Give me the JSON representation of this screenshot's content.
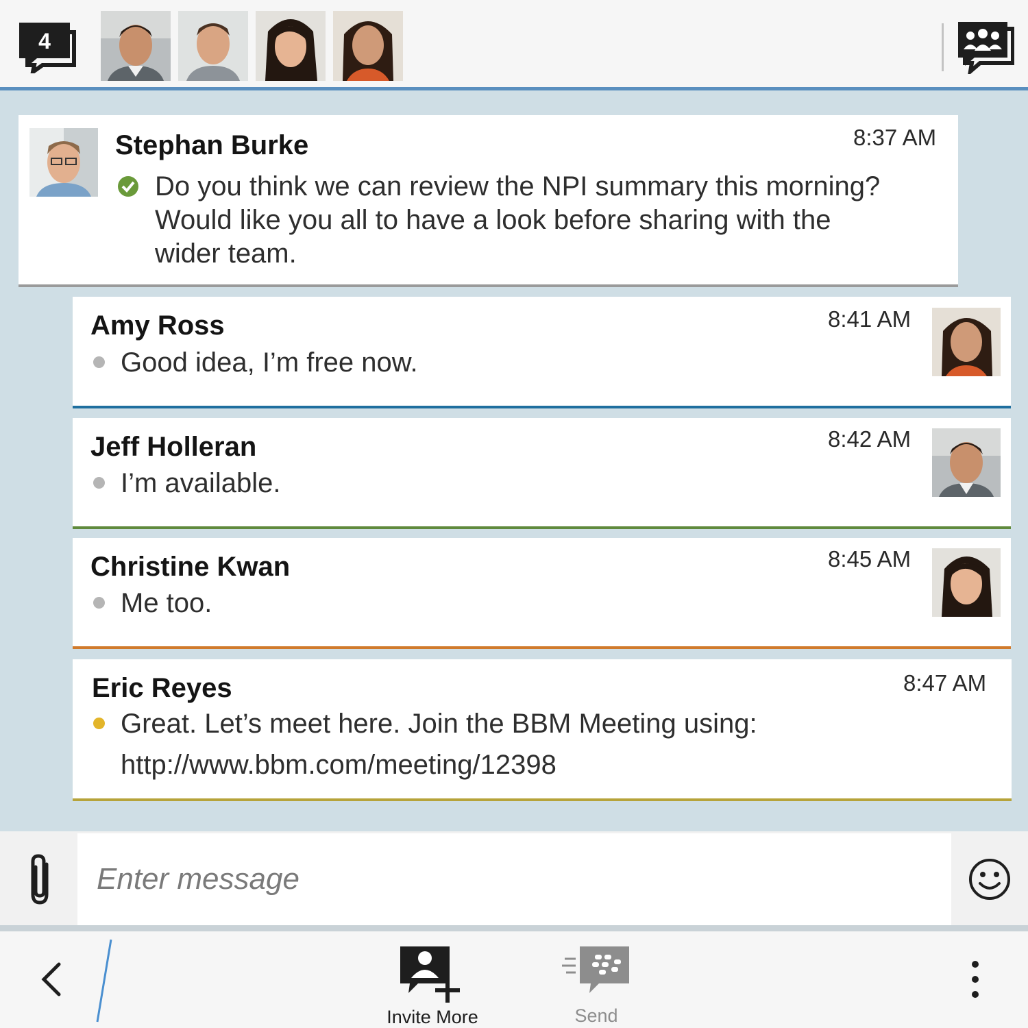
{
  "header": {
    "chat_count": "4",
    "participants": [
      "Jeff Holleran",
      "Stephan Burke",
      "Christine Kwan",
      "Amy Ross"
    ]
  },
  "messages": [
    {
      "name": "Stephan Burke",
      "time": "8:37 AM",
      "lines": [
        "Do you think we can review the NPI summary this morning?",
        "Would like you all to have a look before sharing with the",
        "wider team."
      ],
      "status": "delivered-check",
      "accent": "#9a9a9a"
    },
    {
      "name": "Amy Ross",
      "time": "8:41 AM",
      "text": "Good idea, I’m free now.",
      "accent": "#1f6f9f"
    },
    {
      "name": "Jeff Holleran",
      "time": "8:42 AM",
      "text": "I’m available.",
      "accent": "#5f8a3c"
    },
    {
      "name": "Christine Kwan",
      "time": "8:45 AM",
      "text": "Me too.",
      "accent": "#d07a2c"
    },
    {
      "name": "Eric Reyes",
      "time": "8:47 AM",
      "text": "Great. Let’s meet here. Join the BBM Meeting using:",
      "link": "http://www.bbm.com/meeting/12398",
      "accent": "#b6a33a"
    }
  ],
  "composer": {
    "placeholder": "Enter message"
  },
  "toolbar": {
    "invite_label": "Invite More",
    "send_label": "Send"
  }
}
